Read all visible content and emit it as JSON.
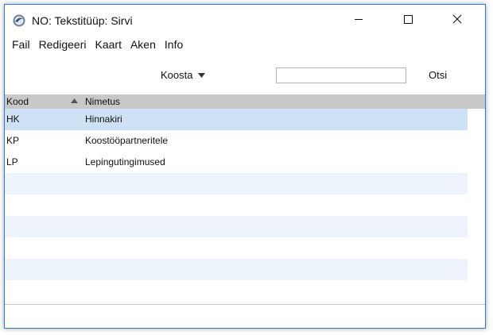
{
  "window": {
    "title": "NO: Tekstitüüp: Sirvi"
  },
  "menu": [
    "Fail",
    "Redigeeri",
    "Kaart",
    "Aken",
    "Info"
  ],
  "toolbar": {
    "sort_label": "Koosta",
    "search_value": "",
    "search_button": "Otsi"
  },
  "table": {
    "columns": [
      "Kood",
      "Nimetus"
    ],
    "sort_column": "Kood",
    "sort_direction": "ascending",
    "rows": [
      {
        "kood": "HK",
        "nimetus": "Hinnakiri",
        "selected": true
      },
      {
        "kood": "KP",
        "nimetus": "Koostööpartneritele",
        "selected": false
      },
      {
        "kood": "LP",
        "nimetus": "Lepingutingimused",
        "selected": false
      },
      {
        "kood": "",
        "nimetus": "",
        "selected": false
      },
      {
        "kood": "",
        "nimetus": "",
        "selected": false
      },
      {
        "kood": "",
        "nimetus": "",
        "selected": false
      },
      {
        "kood": "",
        "nimetus": "",
        "selected": false
      },
      {
        "kood": "",
        "nimetus": "",
        "selected": false
      },
      {
        "kood": "",
        "nimetus": "",
        "selected": false
      }
    ]
  },
  "colors": {
    "header_bg": "#c8c8c8",
    "selected_row": "#cfe2f5",
    "alt_row": "#eef4fb",
    "window_border": "#2b79d8"
  },
  "icons": {
    "app": "app-icon",
    "minimize": "minimize-icon",
    "maximize": "maximize-icon",
    "close": "close-icon",
    "sort_dropdown": "triangle-down-icon",
    "sort_indicator": "sort-ascending-icon"
  }
}
